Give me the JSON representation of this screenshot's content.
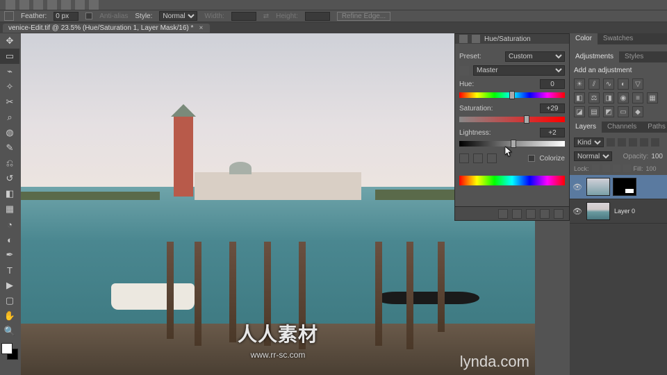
{
  "options_bar": {
    "feather_label": "Feather:",
    "feather_value": "0 px",
    "antialias_label": "Anti-alias",
    "style_label": "Style:",
    "style_value": "Normal",
    "width_label": "Width:",
    "height_label": "Height:",
    "refine_edge_label": "Refine Edge..."
  },
  "document_tab": {
    "title": "venice-Edit.tif @ 23.5% (Hue/Saturation 1, Layer Mask/16) *"
  },
  "watermark": {
    "main": "人人素材",
    "sub": "www.rr-sc.com"
  },
  "lynda": "lynda.com",
  "hsat_panel": {
    "title": "Hue/Saturation",
    "preset_label": "Preset:",
    "preset_value": "Custom",
    "channel_value": "Master",
    "hue": {
      "label": "Hue:",
      "value": "0",
      "pos_pct": 50
    },
    "saturation": {
      "label": "Saturation:",
      "value": "+29",
      "pos_pct": 64
    },
    "lightness": {
      "label": "Lightness:",
      "value": "+2",
      "pos_pct": 51
    },
    "colorize_label": "Colorize"
  },
  "right_panels": {
    "color_tab": "Color",
    "swatches_tab": "Swatches",
    "adjustments_tab": "Adjustments",
    "styles_tab": "Styles",
    "add_adjustment": "Add an adjustment",
    "layers_tab": "Layers",
    "channels_tab": "Channels",
    "paths_tab": "Paths",
    "kind_label": "Kind",
    "blend_mode": "Normal",
    "opacity_label": "Opacity:",
    "opacity_value": "100",
    "lock_label": "Lock:",
    "fill_label": "Fill:",
    "fill_value": "100",
    "layer1_name": "",
    "layer2_name": "Layer 0"
  }
}
